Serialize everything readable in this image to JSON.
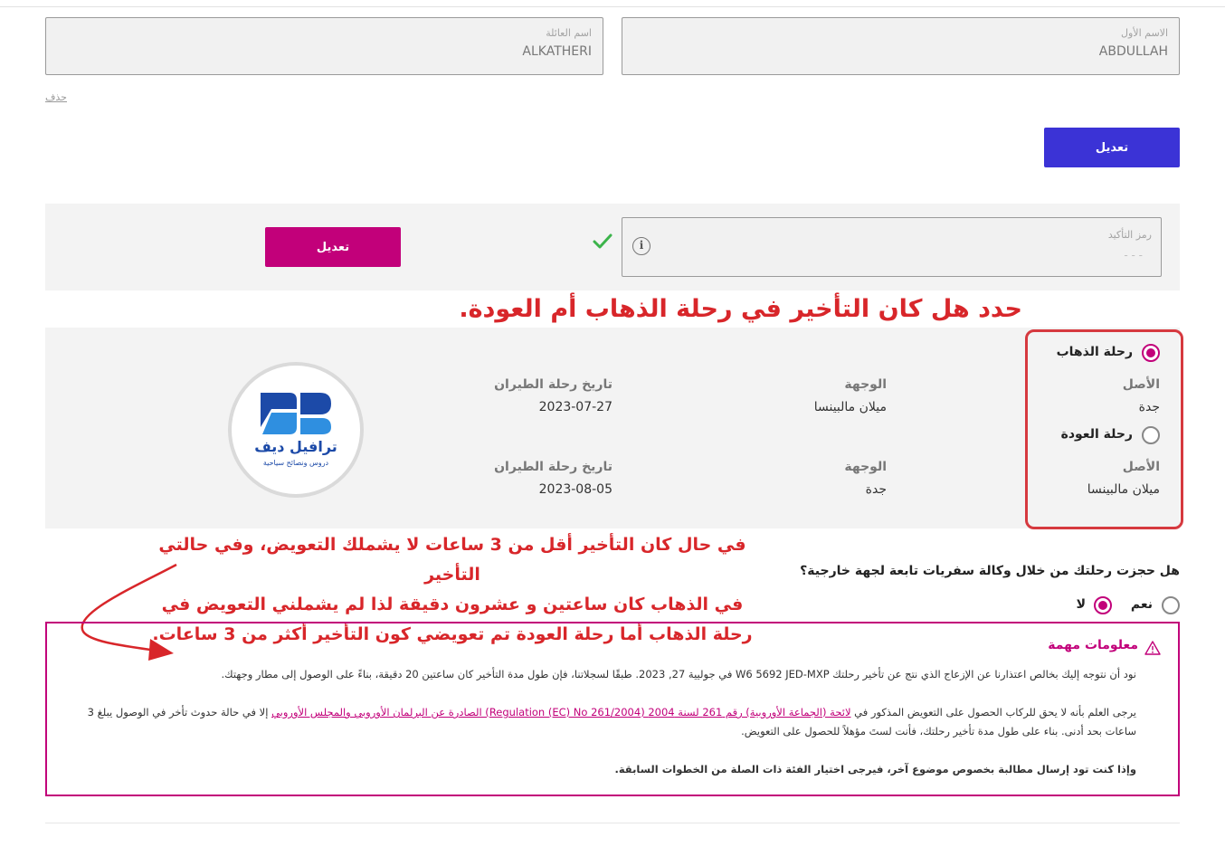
{
  "names": {
    "last_name_label": "اسم العائلة",
    "last_name_value": "ALKATHERI",
    "first_name_label": "الاسم الأول",
    "first_name_value": "ABDULLAH"
  },
  "delete_label": "حذف",
  "edit_button_label": "تعديل",
  "confirmation": {
    "label": "رمز التأكيد",
    "placeholder": "- - -",
    "edit_label": "تعديل"
  },
  "annotation_title": "حدد هل كان التأخير في رحلة الذهاب أم العودة.",
  "flights": {
    "origin_label": "الأصل",
    "destination_label": "الوجهة",
    "date_label": "تاريخ رحلة الطيران",
    "outbound": {
      "label": "رحلة الذهاب",
      "origin": "جدة",
      "destination": "ميلان مالبينسا",
      "date": "2023-07-27"
    },
    "return": {
      "label": "رحلة العودة",
      "origin": "ميلان مالبينسا",
      "destination": "جدة",
      "date": "2023-08-05"
    }
  },
  "logo": {
    "name": "ترافيل ديف",
    "tagline": "دروس ونصائح سياحية"
  },
  "annotation_para": [
    "في حال كان التأخير أقل من 3 ساعات لا يشملك التعويض، وفي حالتي التأخير",
    "في الذهاب كان ساعتين و عشرون دقيقة لذا لم يشملني التعويض في",
    "رحلة الذهاب أما رحلة العودة تم تعويضي كون التأخير أكثر من 3 ساعات."
  ],
  "question": {
    "text": "هل حجزت رحلتك من خلال وكالة سفريات تابعة لجهة خارجية؟",
    "yes": "نعم",
    "no": "لا"
  },
  "info": {
    "title": "معلومات مهمة",
    "p1": "نود أن نتوجه إليك بخالص اعتذارنا عن الإزعاج الذي نتج عن تأخير رحلتك W6 5692 JED-MXP في جوليية 27, 2023. طبقًا لسجلاتنا، فإن طول مدة التأخير كان ساعتين 20 دقيقة، بناءً على الوصول إلى مطار وجهتك.",
    "p2_start": "يرجى العلم بأنه لا يحق للركاب الحصول على التعويض المذكور في ",
    "p2_link": "لائحة (الجماعة الأوروبية) رقم 261 لسنة 2004 (Regulation (EC) No 261/2004) الصادرة عن البرلمان الأوروبي والمجلس الأوروبي",
    "p2_end": " إلا في حالة حدوث تأخر في الوصول يبلغ 3 ساعات بحد أدنى. بناء على طول مدة تأخير رحلتك، فأنت لستَ مؤهلاً للحصول على التعويض.",
    "p3": "وإذا كنت تود إرسال مطالبة بخصوص موضوع آخر، فيرجى اختيار الفئة ذات الصلة من الخطوات السابقة."
  },
  "colors": {
    "primary_blue": "#3b33d6",
    "magenta": "#c2007a",
    "annotation_red": "#d8262a"
  }
}
